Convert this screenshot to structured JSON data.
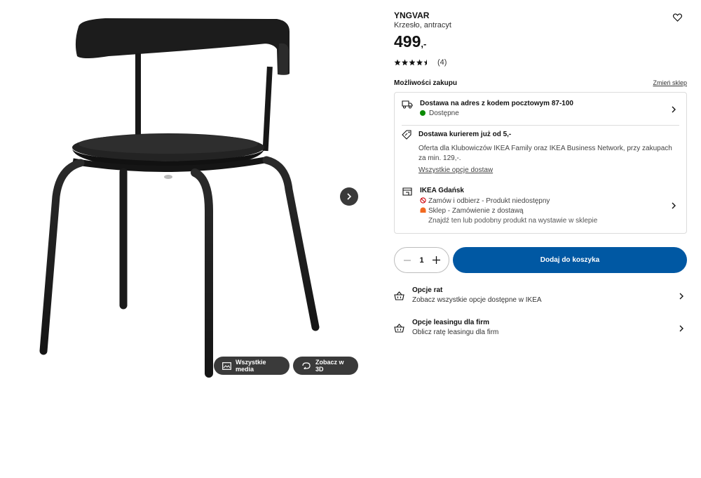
{
  "product": {
    "name": "YNGVAR",
    "description": "Krzesło, antracyt",
    "price": "499",
    "price_suffix": ",-",
    "rating_value": 4.5,
    "rating_count": "(4)"
  },
  "media": {
    "all_media_label": "Wszystkie media",
    "view_3d_label": "Zobacz w 3D"
  },
  "purchase": {
    "title": "Możliwości zakupu",
    "change_store": "Zmień sklep",
    "delivery": {
      "title": "Dostawa na adres z kodem pocztowym 87-100",
      "status": "Dostępne",
      "status_color": "#0a8a00"
    },
    "courier": {
      "title": "Dostawa kurierem już od 5,-",
      "offer": "Oferta dla Klubowiczów IKEA Family oraz IKEA Business Network, przy zakupach za min. 129,-.",
      "all_options": "Wszystkie opcje dostaw"
    },
    "store": {
      "name": "IKEA Gdańsk",
      "click_collect": "Zamów i odbierz - Produkt niedostępny",
      "in_store": "Sklep - Zamówienie z dostawą",
      "find_similar": "Znajdź ten lub podobny produkt na wystawie w sklepie",
      "unavailable_color": "#cc0008",
      "order_color": "#f26a21"
    }
  },
  "cart": {
    "quantity": "1",
    "add_label": "Dodaj do koszyka",
    "accent": "#0058a3"
  },
  "options": [
    {
      "title": "Opcje rat",
      "text": "Zobacz wszystkie opcje dostępne w IKEA"
    },
    {
      "title": "Opcje leasingu dla firm",
      "text": "Oblicz ratę leasingu dla firm"
    }
  ],
  "icons": {
    "favorite": "heart-icon",
    "next": "chevron-right-icon",
    "delivery": "truck-icon",
    "courier": "price-tag-icon",
    "store": "store-icon",
    "installments": "basket-icon"
  }
}
